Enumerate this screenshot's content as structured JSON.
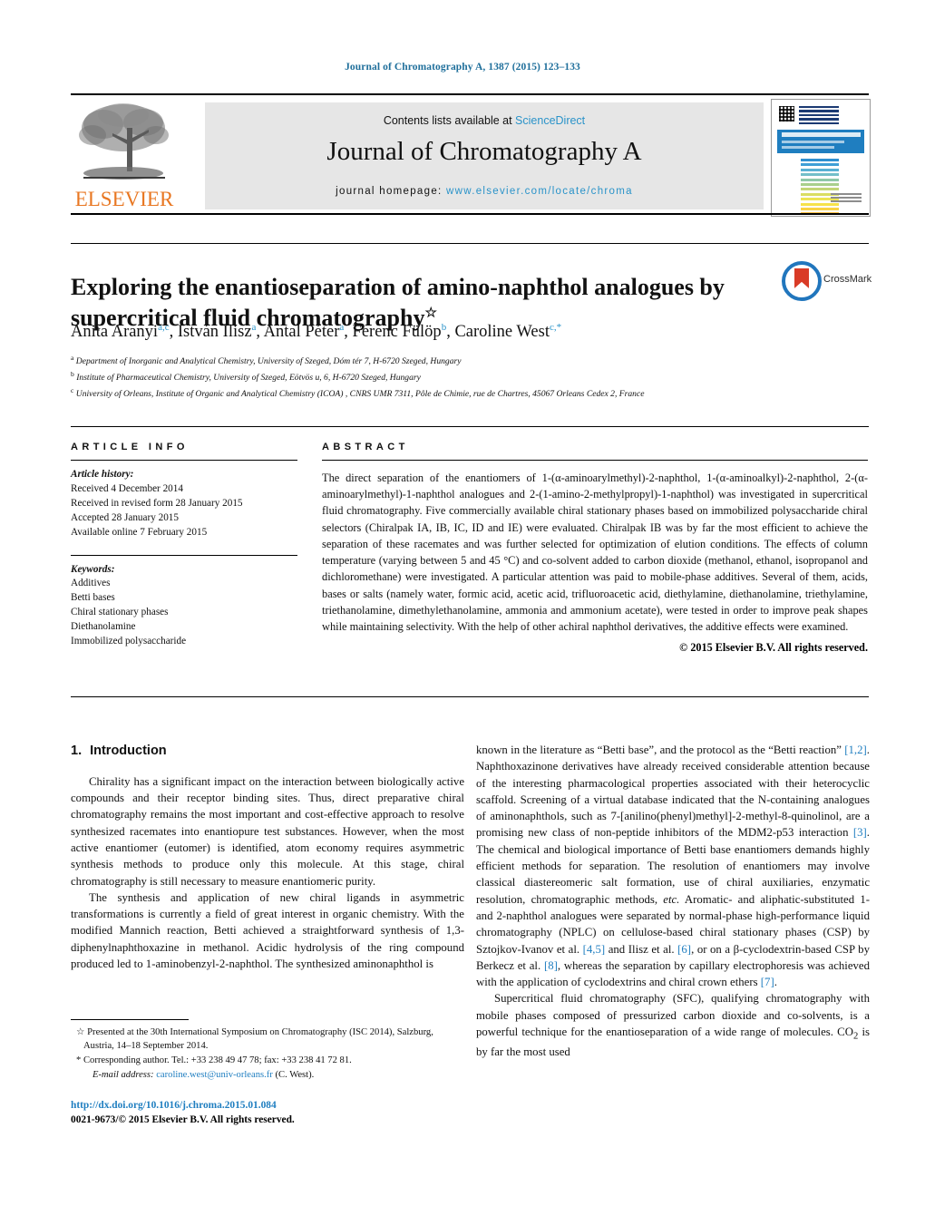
{
  "running_head": "Journal of Chromatography A, 1387 (2015) 123–133",
  "masthead": {
    "contents_prefix": "Contents lists available at ",
    "sciencedirect": "ScienceDirect",
    "journal_title": "Journal of Chromatography A",
    "homepage_prefix": "journal homepage: ",
    "homepage_url": "www.elsevier.com/locate/chroma",
    "publisher": "ELSEVIER"
  },
  "article": {
    "title": "Exploring the enantioseparation of amino-naphthol analogues by supercritical fluid chromatography",
    "title_footnote_marker": "☆",
    "crossmark_label": "CrossMark",
    "authors": [
      {
        "name": "Anita Aranyi",
        "sup": "a,c"
      },
      {
        "name": "István Ilisz",
        "sup": "a"
      },
      {
        "name": "Antal Péter",
        "sup": "a"
      },
      {
        "name": "Ferenc Fülöp",
        "sup": "b"
      },
      {
        "name": "Caroline West",
        "sup": "c,*"
      }
    ],
    "affiliations": [
      {
        "marker": "a",
        "text": "Department of Inorganic and Analytical Chemistry, University of Szeged, Dóm tér 7, H-6720 Szeged, Hungary"
      },
      {
        "marker": "b",
        "text": "Institute of Pharmaceutical Chemistry, University of Szeged, Eötvös u, 6, H-6720 Szeged, Hungary"
      },
      {
        "marker": "c",
        "text": "University of Orleans, Institute of Organic and Analytical Chemistry (ICOA) , CNRS UMR 7311, Pôle de Chimie, rue de Chartres, 45067 Orleans Cedex 2, France"
      }
    ]
  },
  "article_info": {
    "heading": "ARTICLE INFO",
    "history_label": "Article history:",
    "history": [
      "Received 4 December 2014",
      "Received in revised form 28 January 2015",
      "Accepted 28 January 2015",
      "Available online 7 February 2015"
    ],
    "keywords_label": "Keywords:",
    "keywords": [
      "Additives",
      "Betti bases",
      "Chiral stationary phases",
      "Diethanolamine",
      "Immobilized polysaccharide"
    ]
  },
  "abstract": {
    "heading": "ABSTRACT",
    "text": "The direct separation of the enantiomers of 1-(α-aminoarylmethyl)-2-naphthol, 1-(α-aminoalkyl)-2-naphthol, 2-(α-aminoarylmethyl)-1-naphthol analogues and 2-(1-amino-2-methylpropyl)-1-naphthol) was investigated in supercritical fluid chromatography. Five commercially available chiral stationary phases based on immobilized polysaccharide chiral selectors (Chiralpak IA, IB, IC, ID and IE) were evaluated. Chiralpak IB was by far the most efficient to achieve the separation of these racemates and was further selected for optimization of elution conditions. The effects of column temperature (varying between 5 and 45 °C) and co-solvent added to carbon dioxide (methanol, ethanol, isopropanol and dichloromethane) were investigated. A particular attention was paid to mobile-phase additives. Several of them, acids, bases or salts (namely water, formic acid, acetic acid, trifluoroacetic acid, diethylamine, diethanolamine, triethylamine, triethanolamine, dimethylethanolamine, ammonia and ammonium acetate), were tested in order to improve peak shapes while maintaining selectivity. With the help of other achiral naphthol derivatives, the additive effects were examined.",
    "copyright": "© 2015 Elsevier B.V. All rights reserved."
  },
  "introduction": {
    "number": "1.",
    "heading": "Introduction",
    "left_paragraphs": [
      "Chirality has a significant impact on the interaction between biologically active compounds and their receptor binding sites. Thus, direct preparative chiral chromatography remains the most important and cost-effective approach to resolve synthesized racemates into enantiopure test substances. However, when the most active enantiomer (eutomer) is identified, atom economy requires asymmetric synthesis methods to produce only this molecule. At this stage, chiral chromatography is still necessary to measure enantiomeric purity.",
      "The synthesis and application of new chiral ligands in asymmetric transformations is currently a field of great interest in organic chemistry. With the modified Mannich reaction, Betti achieved a straightforward synthesis of 1,3-diphenylnaphthoxazine in methanol. Acidic hydrolysis of the ring compound produced led to 1-aminobenzyl-2-naphthol. The synthesized aminonaphthol is"
    ],
    "right_p1_a": "known in the literature as “Betti base”, and the protocol as the “Betti reaction” ",
    "right_p1_ref1": "[1,2]",
    "right_p1_b": ". Naphthoxazinone derivatives have already received considerable attention because of the interesting pharmacological properties associated with their heterocyclic scaffold. Screening of a virtual database indicated that the N-containing analogues of aminonaphthols, such as 7-[anilino(phenyl)methyl]-2-methyl-8-quinolinol, are a promising new class of non-peptide inhibitors of the MDM2-p53 interaction ",
    "right_p1_ref2": "[3]",
    "right_p1_c": ". The chemical and biological importance of Betti base enantiomers demands highly efficient methods for separation. The resolution of enantiomers may involve classical diastereomeric salt formation, use of chiral auxiliaries, enzymatic resolution, chromatographic methods, ",
    "right_p1_etc": "etc.",
    "right_p1_d": " Aromatic- and aliphatic-substituted 1- and 2-naphthol analogues were separated by normal-phase high-performance liquid chromatography (NPLC) on cellulose-based chiral stationary phases (CSP) by Sztojkov-Ivanov et al. ",
    "right_p1_ref3": "[4,5]",
    "right_p1_e": " and Ilisz et al. ",
    "right_p1_ref4": "[6]",
    "right_p1_f": ", or on a β-cyclodextrin-based CSP by Berkecz et al. ",
    "right_p1_ref5": "[8]",
    "right_p1_g": ", whereas the separation by capillary electrophoresis was achieved with the application of cyclodextrins and chiral crown ethers ",
    "right_p1_ref6": "[7]",
    "right_p1_h": ".",
    "right_p2_a": "Supercritical fluid chromatography (SFC), qualifying chromatography with mobile phases composed of pressurized carbon dioxide and co-solvents, is a powerful technique for the enantioseparation of a wide range of molecules. CO",
    "right_p2_sub": "2",
    "right_p2_b": " is by far the most used"
  },
  "footnotes": {
    "star_marker": "☆",
    "star_text": "Presented at the 30th International Symposium on Chromatography (ISC 2014), Salzburg, Austria, 14–18 September 2014.",
    "corresponding_marker": "*",
    "corresponding_text": "Corresponding author. Tel.: +33 238 49 47 78; fax: +33 238 41 72 81.",
    "email_label": "E-mail address:",
    "email": "caroline.west@univ-orleans.fr",
    "email_suffix": "(C. West)."
  },
  "footer": {
    "doi": "http://dx.doi.org/10.1016/j.chroma.2015.01.084",
    "issn_line": "0021-9673/© 2015 Elsevier B.V. All rights reserved."
  },
  "colors": {
    "link_blue": "#1f7ec0",
    "elsevier_orange": "#E87722",
    "band_grey": "#e6e6e6"
  }
}
